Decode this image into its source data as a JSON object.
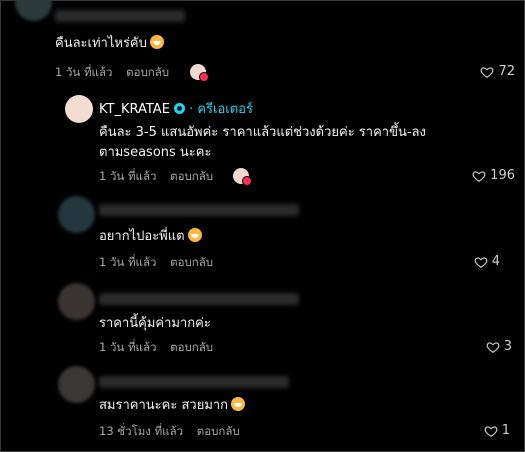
{
  "comments": [
    {
      "text": "คืนละเท่าไหร่คับ",
      "time": "1 วัน ที่แล้ว",
      "reply_label": "ตอบกลับ",
      "likes": "72",
      "emoji": "grinning-face"
    },
    {
      "author": "KT_KRATAE",
      "creator_tag": "· ครีเอเตอร์",
      "text_line1": "คืนละ 3-5 แสนอัพค่ะ ราคาแล้วแต่ช่วงด้วยค่ะ ราคาขึ้น-ลง",
      "text_line2": "ตามseasons นะคะ",
      "time": "1 วัน ที่แล้ว",
      "reply_label": "ตอบกลับ",
      "likes": "196"
    },
    {
      "text": "อยากไปอะพี่แต",
      "time": "1 วัน ที่แล้ว",
      "reply_label": "ตอบกลับ",
      "likes": "4",
      "emoji": "smiling-face-with-hearts"
    },
    {
      "text": "ราคานี้คุ้มค่ามากค่ะ",
      "time": "1 วัน ที่แล้ว",
      "reply_label": "ตอบกลับ",
      "likes": "3"
    },
    {
      "text": "สมราคานะคะ สวยมาก",
      "time": "13 ชั่วโมง ที่แล้ว",
      "reply_label": "ตอบกลับ",
      "likes": "1",
      "emoji": "smiling-face-with-hearts"
    }
  ],
  "colors": {
    "background": "#000000",
    "text": "#f2f2f2",
    "meta": "#a8a8a8",
    "creator_accent": "#20d5ec",
    "badge_red": "#ff2d55"
  }
}
